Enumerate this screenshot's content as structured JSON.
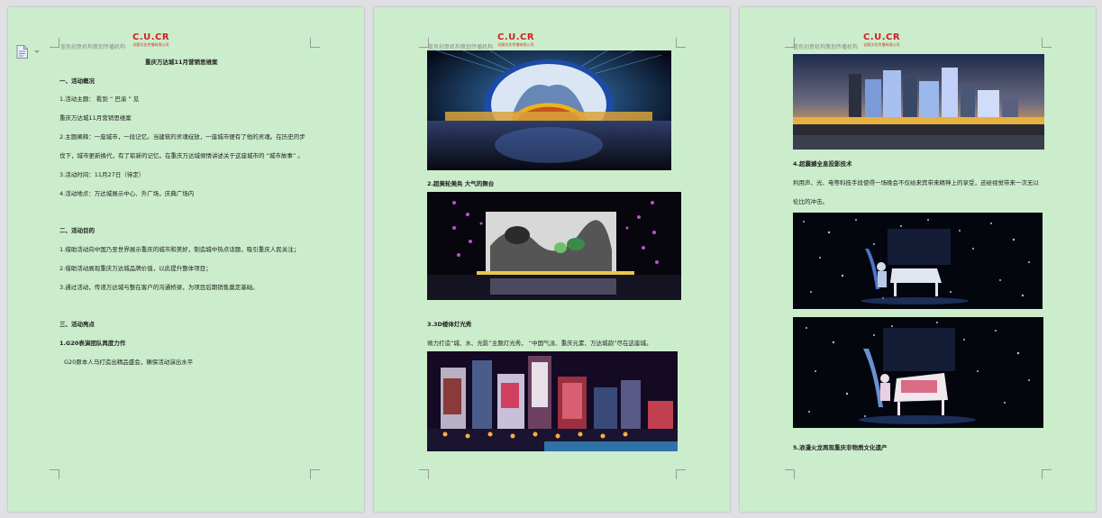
{
  "header": {
    "small_text": "蓝色创意机构策划传播机构",
    "logo_text": "C.U.CR",
    "logo_subtext": "创意文化传播有限公司"
  },
  "page1": {
    "title": "重庆万达城11月营销思维案",
    "lines": [
      "一、活动概况",
      "1.活动主题：  看到  “ 巴渝 ”  见",
      "重庆万达城11月营销思维案",
      "2.主题阐释：一座城市，一段记忆。当建筑的灵魂绽放，一座城市便有了他的灵魂。在历史的步",
      "伐下，城市更新换代，有了崭新的记忆。在重庆万达城倾情讲述关于这座城市的  “城市故事” 。",
      "3.活动时间：11月27日（待定）",
      "4.活动地点：万达城展示中心、外广场，庆典广场内",
      "二、活动目的",
      "1.借助活动向中国乃至世界展示重庆的城市和美好，制造城中热点话题，吸引重庆人民关注；",
      "2.借助活动展现重庆万达城品牌价值，以此提升整体项目；",
      "3.通过活动，传递万达城与整在客户的沟通桥梁，为项目后期销售奠定基础。",
      "三、活动亮点",
      "1.G20表演团队再度力作",
      "G20原本人马打造出精品盛会，确保活动演出水平"
    ]
  },
  "page2": {
    "lines": [
      "2.超美轮美奂 大气的舞台",
      "3.3D楼体灯光秀",
      "倾力打造“城、水、光影”主题灯光秀，  “中国气派、重庆元素、万达城韵”尽在这座城。"
    ]
  },
  "page3": {
    "lines": [
      "4.超震撼全息投影技术",
      "利用声、光、电等科技手段使得一场晚会不仅给来宾带来精神上的享受，还给视觉带来一次无以",
      "伦比的冲击。",
      "5.浪漫火龙再现重庆非物质文化遗产"
    ]
  },
  "icons": {
    "doc": "document-icon",
    "dropdown": "dropdown-arrow-icon"
  },
  "colors": {
    "page_background": "#cbedcb",
    "workspace_background": "#dfdfe4",
    "logo_red": "#d42020"
  }
}
